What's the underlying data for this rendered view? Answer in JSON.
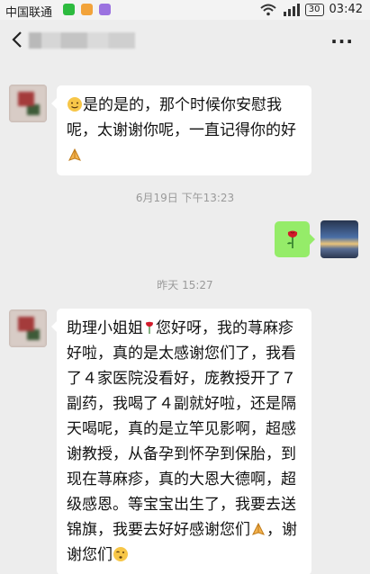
{
  "status_bar": {
    "carrier": "中国联通",
    "battery": "30",
    "time": "03:42",
    "signal_label": "4G"
  },
  "nav": {
    "back_icon": "chevron-left-icon",
    "more_label": "···"
  },
  "messages": [
    {
      "side": "left",
      "segments": [
        "是的是的，那个时候你安慰我呢，太谢谢你呢，一直记得你的好"
      ]
    },
    {
      "timestamp": "6月19日 下午13:23",
      "side": "right",
      "content_icon": "rose-emoji-icon"
    },
    {
      "timestamp": "昨天 15:27",
      "side": "left",
      "segments": [
        "助理小姐姐",
        "您好呀，我的荨麻疹好啦，真的是太感谢您们了，我看了４家医院没看好，庞教授开了７副药，我喝了４副就好啦，还是隔天喝呢，真的是立竿见影啊，超感谢教授，从备孕到怀孕到保胎，到现在荨麻疹，真的大恩大德啊，超级感恩。等宝宝出生了，我要去送锦旗，我要去好好感谢您们",
        "，谢谢您们"
      ]
    }
  ],
  "colors": {
    "background": "#ededed",
    "own_bubble": "#95ec69",
    "other_bubble": "#ffffff",
    "timestamp": "#9a9a9a"
  }
}
